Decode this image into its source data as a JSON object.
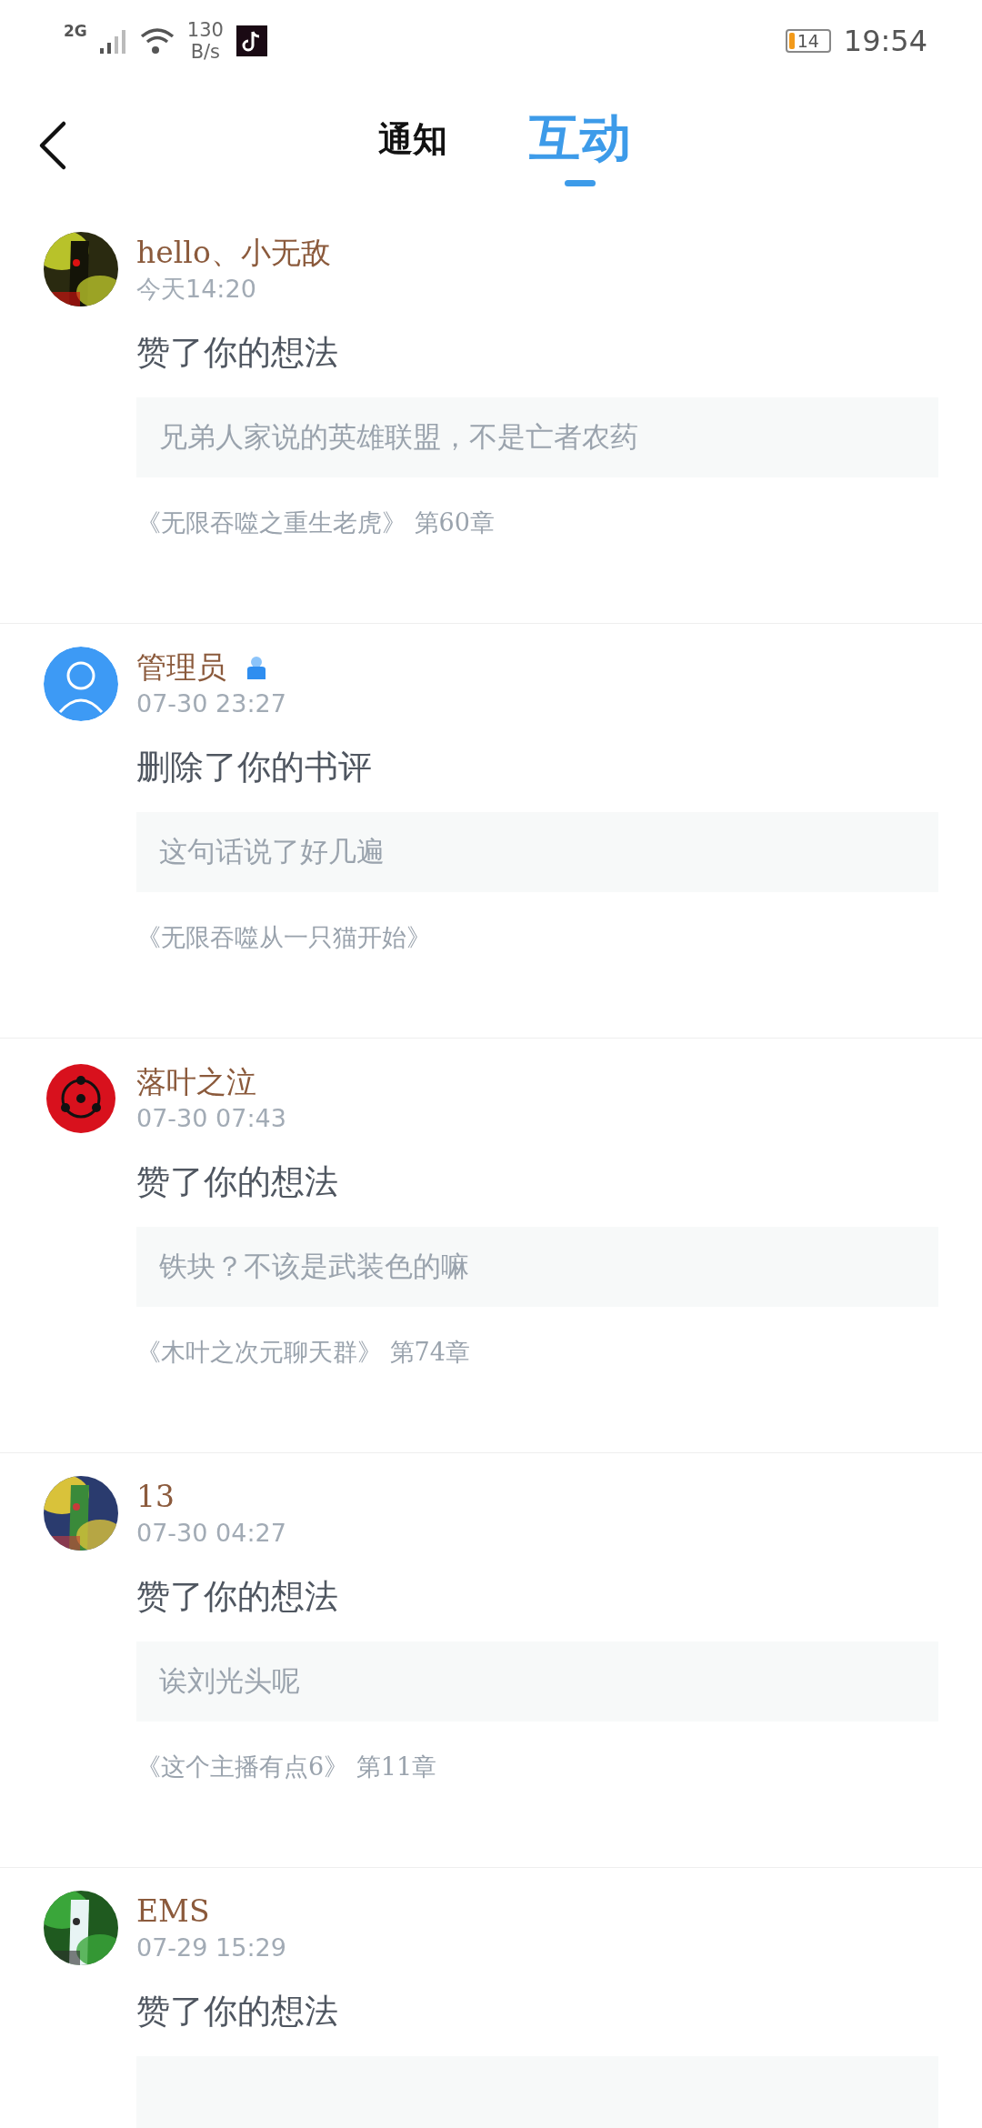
{
  "status_bar": {
    "network": "2G",
    "speed_value": "130",
    "speed_unit": "B/s",
    "battery": "14",
    "time": "19:54"
  },
  "header": {
    "tabs": [
      {
        "label": "通知",
        "selected": false
      },
      {
        "label": "互动",
        "selected": true
      }
    ]
  },
  "items": [
    {
      "name": "hello、小无敌",
      "admin": false,
      "time": "今天14:20",
      "action": "赞了你的想法",
      "quote": "兄弟人家说的英雄联盟，不是亡者农药",
      "book": "《无限吞噬之重生老虎》",
      "chapter": "第60章"
    },
    {
      "avatar": {
        "kind": "default"
      },
      "name": "管理员",
      "admin": true,
      "time": "07-30 23:27",
      "action": "删除了你的书评",
      "quote": "这句话说了好几遍",
      "book": "《无限吞噬从一只猫开始》"
    },
    {
      "name": "落叶之泣",
      "admin": false,
      "time": "07-30 07:43",
      "action": "赞了你的想法",
      "quote": "铁块？不该是武装色的嘛",
      "book": "《木叶之次元聊天群》",
      "chapter": "第74章"
    },
    {
      "name": "13",
      "admin": false,
      "time": "07-30 04:27",
      "action": "赞了你的想法",
      "quote": "诶刘光头呢",
      "book": "《这个主播有点6》",
      "chapter": "第11章"
    },
    {
      "name": "EMS",
      "admin": false,
      "time": "07-29 15:29",
      "action": "赞了你的想法"
    }
  ]
}
